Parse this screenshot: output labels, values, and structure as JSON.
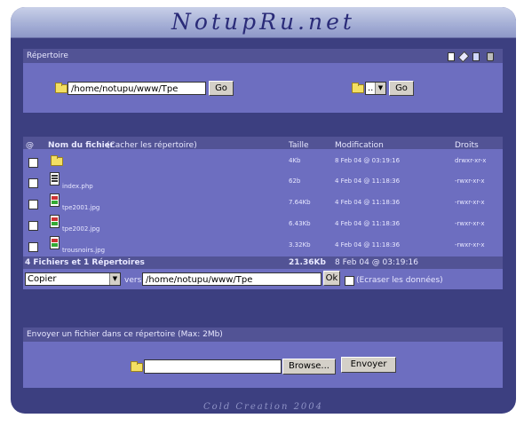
{
  "header": {
    "logo": "NotupRu.net"
  },
  "directory": {
    "title": "Répertoire",
    "path_value": "/home/notupu/www/Tpe",
    "go_label": "Go",
    "select_value": "..",
    "go2_label": "Go"
  },
  "files": {
    "columns": {
      "at": "@",
      "name": "Nom du fichier",
      "hide_dirs": "(Cacher les répertoire)",
      "size": "Taille",
      "modified": "Modification",
      "rights": "Droits"
    },
    "rows": [
      {
        "name": "",
        "icon": "folder-icon",
        "size": "4Kb",
        "modified": "8 Feb 04 @ 03:19:16",
        "rights": "drwxr-xr-x"
      },
      {
        "name": "index.php",
        "icon": "php-file-icon",
        "size": "62b",
        "modified": "4 Feb 04 @ 11:18:36",
        "rights": "-rwxr-xr-x"
      },
      {
        "name": "tpe2001.jpg",
        "icon": "image-file-icon",
        "size": "7.64Kb",
        "modified": "4 Feb 04 @ 11:18:36",
        "rights": "-rwxr-xr-x"
      },
      {
        "name": "tpe2002.jpg",
        "icon": "image-file-icon",
        "size": "6.43Kb",
        "modified": "4 Feb 04 @ 11:18:36",
        "rights": "-rwxr-xr-x"
      },
      {
        "name": "trousnoirs.jpg",
        "icon": "image-file-icon",
        "size": "3.32Kb",
        "modified": "4 Feb 04 @ 11:18:36",
        "rights": "-rwxr-xr-x"
      }
    ],
    "totals": {
      "label": "4 Fichiers et 1 Répertoires",
      "size": "21.36Kb",
      "modified": "8 Feb 04 @ 03:19:16"
    },
    "action": {
      "select_value": "Copier",
      "vers_label": "vers",
      "target_value": "/home/notupu/www/Tpe",
      "ok_label": "Ok",
      "overwrite_label": "(Ecraser les données)"
    }
  },
  "upload": {
    "title": "Envoyer un fichier dans ce répertoire (Max: 2Mb)",
    "browse_label": "Browse...",
    "send_label": "Envoyer"
  },
  "footer": {
    "credit": "Cold Creation 2004"
  },
  "colors": {
    "frame": "#3c3f80",
    "panel": "#6d6ec0",
    "panel_title": "#525395"
  }
}
